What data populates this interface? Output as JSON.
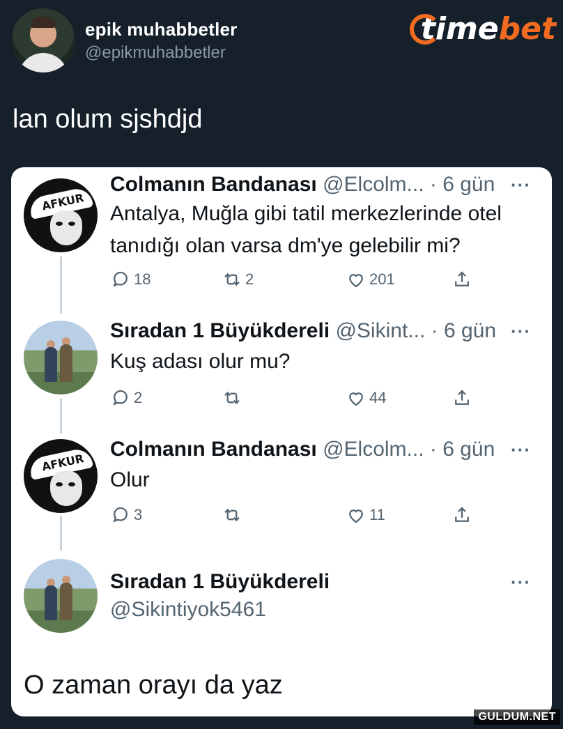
{
  "header": {
    "display_name": "epik muhabbetler",
    "handle": "@epikmuhabbetler"
  },
  "brand": {
    "part1": "time",
    "part2": "bet",
    "accent": "#f26b21"
  },
  "tweet": {
    "text": "lan olum sjshdjd"
  },
  "quoted_thread": [
    {
      "name": "Colmanın Bandanası",
      "handle_time": "@Elcolm... · 6 gün",
      "avatar_label": "AFKUR",
      "body": [
        "Antalya, Muğla gibi tatil merkezlerinde otel",
        "tanıdığı olan varsa dm'ye gelebilir mi?"
      ],
      "replies": "18",
      "retweets": "2",
      "likes": "201"
    },
    {
      "name": "Sıradan 1 Büyükdereli",
      "handle_time": "@Sikint... · 6 gün",
      "body": [
        "Kuş adası olur mu?"
      ],
      "replies": "2",
      "retweets": "",
      "likes": "44"
    },
    {
      "name": "Colmanın Bandanası",
      "handle_time": "@Elcolm... · 6 gün",
      "avatar_label": "AFKUR",
      "body": [
        "Olur"
      ],
      "replies": "3",
      "retweets": "",
      "likes": "11"
    },
    {
      "name": "Sıradan 1 Büyükdereli",
      "handle": "@Sikintiyok5461",
      "body": [
        "O zaman orayı da yaz"
      ]
    }
  ],
  "more_label": "···",
  "watermark": "GULDUM.NET"
}
